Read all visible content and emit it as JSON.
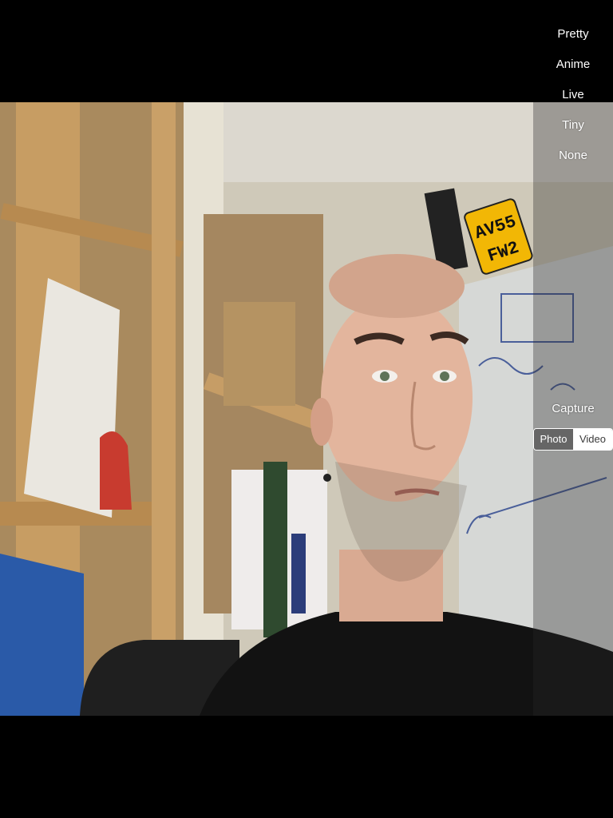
{
  "filters": {
    "items": [
      {
        "label": "Pretty"
      },
      {
        "label": "Anime"
      },
      {
        "label": "Live"
      },
      {
        "label": "Tiny"
      },
      {
        "label": "None"
      }
    ]
  },
  "controls": {
    "capture_label": "Capture",
    "mode_options": [
      "Photo",
      "Video"
    ],
    "selected_mode": "Photo"
  },
  "scene": {
    "plate_text_line1": "AV55",
    "plate_text_line2": "FW2"
  },
  "colors": {
    "background": "#000000",
    "text": "#ffffff",
    "plate": "#f2b705"
  }
}
